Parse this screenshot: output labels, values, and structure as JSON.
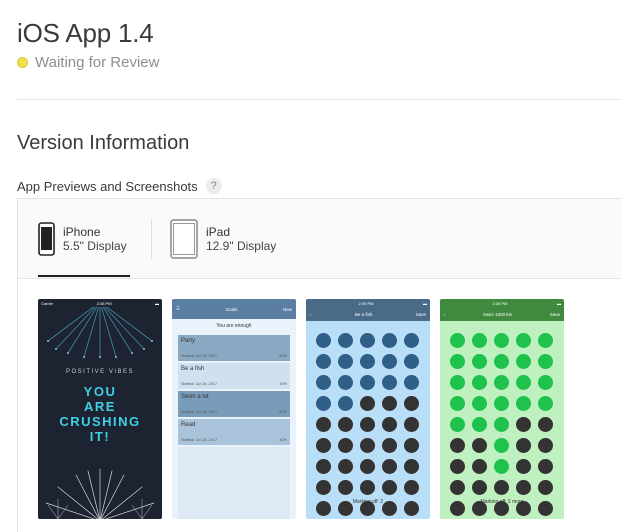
{
  "header": {
    "title": "iOS App 1.4",
    "status": "Waiting for Review"
  },
  "version": {
    "heading": "Version Information",
    "subheading": "App Previews and Screenshots",
    "help": "?"
  },
  "tabs": [
    {
      "name": "iPhone",
      "size": "5.5\" Display"
    },
    {
      "name": "iPad",
      "size": "12.9\" Display"
    }
  ],
  "shots": {
    "s1": {
      "carrier": "Carrier",
      "time": "2:38 PM",
      "tagline": "POSITIVE VIBES",
      "line1": "YOU",
      "line2": "ARE",
      "line3": "CRUSHING",
      "line4": "IT!"
    },
    "s2": {
      "title": "Goals",
      "right": "New",
      "subtitle": "You are enough",
      "items": [
        {
          "name": "Party",
          "meta": "Started: Oct 26, 2017",
          "pct": "80%"
        },
        {
          "name": "Be a fish",
          "meta": "Started: Oct 26, 2017",
          "pct": "15%"
        },
        {
          "name": "Swim a lot",
          "meta": "Started: Oct 26, 2017",
          "pct": "60%"
        },
        {
          "name": "Read",
          "meta": "Started: Oct 26, 2017",
          "pct": "40%"
        }
      ]
    },
    "s3": {
      "time": "2:39 PM",
      "title": "Be a fish",
      "right": "Save",
      "marking": "Marking off: 2"
    },
    "s4": {
      "time": "2:38 PM",
      "title": "Swim 1000 km",
      "right": "Save",
      "marking": "Marking off: 2 more"
    }
  },
  "colors": {
    "status_dot": "#f2e04a",
    "dark_bg": "#1d2330",
    "accent_cyan": "#40d0e6",
    "blue_dot": "#2f5f86",
    "green_dot": "#1fc24d",
    "empty_dot": "#333333"
  }
}
